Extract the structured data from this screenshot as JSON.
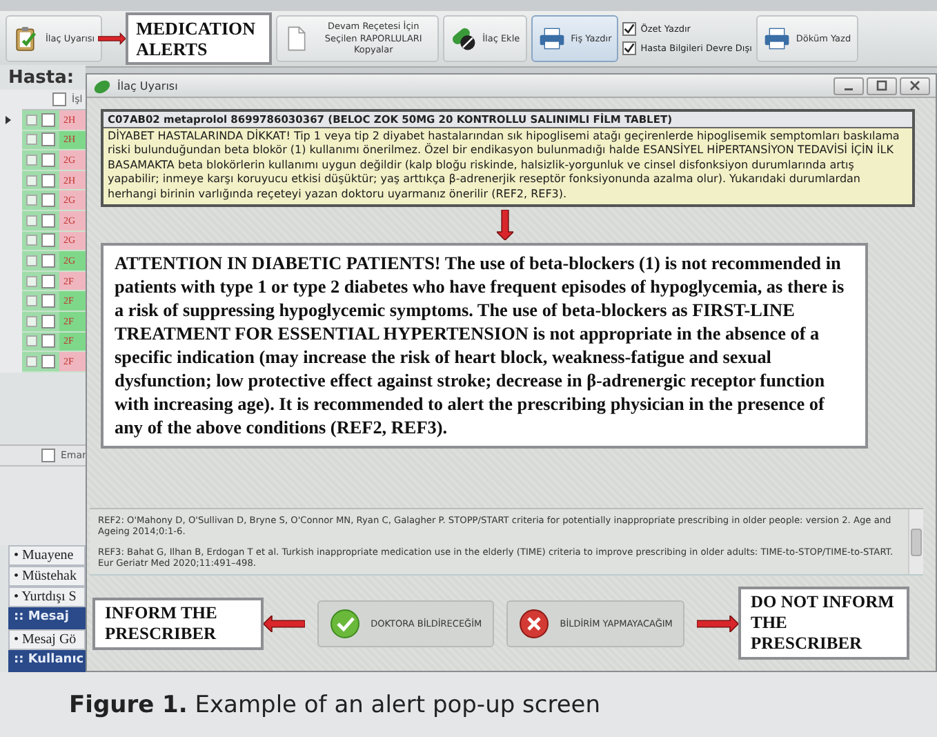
{
  "toolbar": {
    "items": [
      {
        "kind": "alert",
        "label": "İlaç Uyarısı"
      },
      {
        "kind": "callout",
        "label": "MEDICATION ALERTS"
      },
      {
        "kind": "copy",
        "label": "Devam Reçetesi İçin Seçilen RAPORLULARI Kopyalar"
      },
      {
        "kind": "add",
        "label": "İlaç Ekle"
      },
      {
        "kind": "print",
        "label": "Fiş Yazdır",
        "selected": true
      },
      {
        "kind": "checks",
        "options": [
          {
            "label": "Özet Yazdır",
            "checked": true
          },
          {
            "label": "Hasta Bilgileri Devre Dışı",
            "checked": true
          }
        ]
      },
      {
        "kind": "print",
        "label": "Döküm Yazd"
      }
    ]
  },
  "patient": {
    "label": "Hasta:"
  },
  "list": {
    "column": "İşl",
    "all_checked": false,
    "rows": [
      {
        "code": "2H",
        "color": "#f0b6c0",
        "current": true,
        "checked": false
      },
      {
        "code": "2H",
        "color": "#7fd88a",
        "current": false,
        "checked": false
      },
      {
        "code": "2G",
        "color": "#f0b6c0",
        "current": false,
        "checked": false
      },
      {
        "code": "2H",
        "color": "#f0b6c0",
        "current": false,
        "checked": false
      },
      {
        "code": "2G",
        "color": "#f0b6c0",
        "current": false,
        "checked": false
      },
      {
        "code": "2G",
        "color": "#f0b6c0",
        "current": false,
        "checked": false
      },
      {
        "code": "2G",
        "color": "#f0b6c0",
        "current": false,
        "checked": false
      },
      {
        "code": "2G",
        "color": "#7fd88a",
        "current": false,
        "checked": false
      },
      {
        "code": "2F",
        "color": "#f0b6c0",
        "current": false,
        "checked": false
      },
      {
        "code": "2F",
        "color": "#7fd88a",
        "current": false,
        "checked": false
      },
      {
        "code": "2F",
        "color": "#7fd88a",
        "current": false,
        "checked": false
      },
      {
        "code": "2F",
        "color": "#7fd88a",
        "current": false,
        "checked": false
      },
      {
        "code": "2F",
        "color": "#f0b6c0",
        "current": false,
        "checked": false
      }
    ]
  },
  "second_list": {
    "column": "Emar",
    "all_checked": false
  },
  "side_menu": {
    "items": [
      {
        "kind": "link",
        "label": "• Muayene"
      },
      {
        "kind": "link",
        "label": "• Müstehak"
      },
      {
        "kind": "link",
        "label": "• Yurtdışı S"
      },
      {
        "kind": "header",
        "label": ":: Mesaj"
      },
      {
        "kind": "link",
        "label": "• Mesaj Gö"
      },
      {
        "kind": "header",
        "label": ":: Kullanıc"
      }
    ]
  },
  "dialog": {
    "title": "İlaç Uyarısı",
    "drug": "C07AB02 metaprolol 8699786030367 (BELOC ZOK 50MG 20 KONTROLLU SALINIMLI FİLM TABLET)",
    "warning": "DİYABET HASTALARINDA DİKKAT! Tip 1 veya tip 2 diyabet hastalarından sık hipoglisemi atağı geçirenlerde hipoglisemik semptomları baskılama riski bulunduğundan beta blokör (1) kullanımı önerilmez. Özel bir endikasyon bulunmadığı halde ESANSİYEL HİPERTANSİYON TEDAVİSİ İÇİN İLK BASAMAKTA beta blokörlerin kullanımı uygun değildir (kalp bloğu riskinde, halsizlik-yorgunluk ve cinsel disfonksiyon durumlarında artış yapabilir; inmeye karşı koruyucu etkisi düşüktür; yaş arttıkça β-adrenerjik reseptör fonksiyonunda azalma olur). Yukarıdaki durumlardan herhangi birinin varlığında reçeteyi yazan doktoru uyarmanız önerilir (REF2, REF3).",
    "translation": "ATTENTION IN DIABETIC PATIENTS! The use of beta-blockers (1) is not recommended in patients with type 1 or type 2 diabetes who have frequent episodes of hypoglycemia, as there is a risk of suppressing hypoglycemic symptoms. The use of beta-blockers as FIRST-LINE TREATMENT FOR ESSENTIAL HYPERTENSION is not appropriate in the absence of a specific indication (may increase the risk of heart block, weakness-fatigue and sexual dysfunction; low protective effect against stroke; decrease in β-adrenergic receptor function with increasing age). It is recommended to alert the prescribing physician in the presence of any of the above conditions (REF2, REF3).",
    "references": [
      "REF2: O'Mahony D, O'Sullivan D, Bryne S, O'Connor MN, Ryan C, Galagher P. STOPP/START criteria for potentially inappropriate prescribing in older people: version 2. Age and Ageing 2014;0:1-6.",
      "REF3: Bahat G, Ilhan B, Erdogan T et al. Turkish inappropriate medication use in the elderly (TIME) criteria to improve prescribing in older adults: TIME-to-STOP/TIME-to-START. Eur Geriatr Med 2020;11:491–498."
    ],
    "actions": [
      {
        "kind": "note",
        "label": "INFORM THE PRESCRIBER"
      },
      {
        "kind": "confirm",
        "label": "DOKTORA BİLDİRECEĞİM"
      },
      {
        "kind": "cancel",
        "label": "BİLDİRİM YAPMAYACAĞIM"
      },
      {
        "kind": "note",
        "label": "DO NOT INFORM THE PRESCRIBER"
      }
    ]
  },
  "caption": "**Figure 1.** Example of an alert pop-up screen"
}
